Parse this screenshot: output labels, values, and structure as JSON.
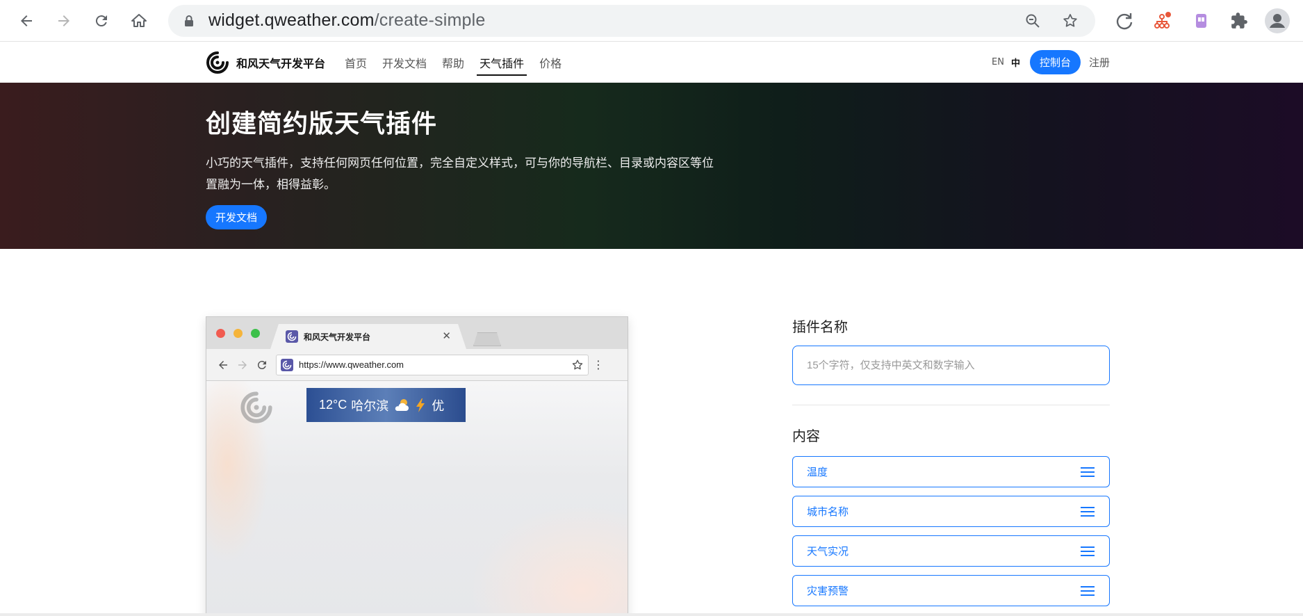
{
  "browser": {
    "url_host": "widget.qweather.com",
    "url_path": "/create-simple"
  },
  "site": {
    "brand": "和风天气开发平台",
    "nav": [
      "首页",
      "开发文档",
      "帮助",
      "天气插件",
      "价格"
    ],
    "active_nav": "天气插件",
    "lang_en": "EN",
    "lang_zh": "中",
    "console": "控制台",
    "register": "注册"
  },
  "hero": {
    "title": "创建简约版天气插件",
    "description": "小巧的天气插件，支持任何网页任何位置，完全自定义样式，可与你的导航栏、目录或内容区等位置融为一体，相得益彰。",
    "button": "开发文档"
  },
  "preview": {
    "tab_title": "和风天气开发平台",
    "url": "https://www.qweather.com",
    "widget": {
      "temp": "12°C",
      "city": "哈尔滨",
      "aqi": "优"
    }
  },
  "form": {
    "name_label": "插件名称",
    "name_placeholder": "15个字符，仅支持中英文和数字输入",
    "content_label": "内容",
    "content_items": [
      "温度",
      "城市名称",
      "天气实况",
      "灾害预警"
    ]
  },
  "colors": {
    "accent": "#1677ff"
  }
}
